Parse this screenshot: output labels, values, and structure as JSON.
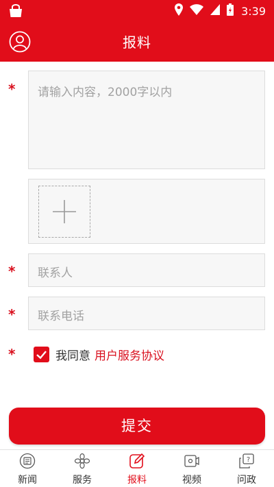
{
  "status_bar": {
    "time": "3:39"
  },
  "header": {
    "title": "报料"
  },
  "form": {
    "content_placeholder": "请输入内容，2000字以内",
    "contact_placeholder": "联系人",
    "phone_placeholder": "联系电话",
    "required_mark": "*",
    "agree_prefix": "我同意",
    "agree_link": "用户服务协议",
    "agree_checked": true,
    "submit_label": "提交"
  },
  "tabs": [
    {
      "label": "新闻",
      "icon": "news-icon",
      "active": false
    },
    {
      "label": "服务",
      "icon": "service-icon",
      "active": false
    },
    {
      "label": "报料",
      "icon": "report-icon",
      "active": true
    },
    {
      "label": "视频",
      "icon": "video-icon",
      "active": false
    },
    {
      "label": "问政",
      "icon": "inquiry-icon",
      "active": false
    }
  ],
  "colors": {
    "brand": "#e10d1a",
    "placeholder": "#a2a2a2",
    "field_bg": "#f7f7f7"
  }
}
